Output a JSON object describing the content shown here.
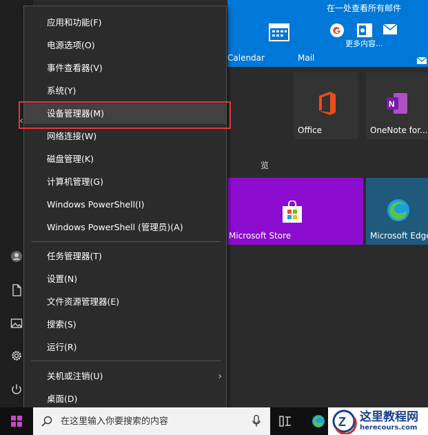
{
  "tiles": {
    "calendar": "Calendar",
    "mail": "Mail",
    "mail_header": "在一处查看所有邮件",
    "mail_more": "更多内容...",
    "office": "Office",
    "onenote": "OneNote for...",
    "store": "Microsoft Store",
    "edge": "Microsoft Edge",
    "group_fragment": "览"
  },
  "menu": {
    "items": [
      {
        "label": "应用和功能(F)"
      },
      {
        "label": "电源选项(O)"
      },
      {
        "label": "事件查看器(V)"
      },
      {
        "label": "系统(Y)"
      },
      {
        "label": "设备管理器(M)"
      },
      {
        "label": "网络连接(W)"
      },
      {
        "label": "磁盘管理(K)"
      },
      {
        "label": "计算机管理(G)"
      },
      {
        "label": "Windows PowerShell(I)"
      },
      {
        "label": "Windows PowerShell (管理员)(A)"
      },
      {
        "label": "任务管理器(T)"
      },
      {
        "label": "设置(N)"
      },
      {
        "label": "文件资源管理器(E)"
      },
      {
        "label": "搜索(S)"
      },
      {
        "label": "运行(R)"
      },
      {
        "label": "关机或注销(U)"
      },
      {
        "label": "桌面(D)"
      }
    ]
  },
  "taskbar": {
    "search_placeholder": "在这里输入你要搜索的内容"
  },
  "watermark": {
    "title": "这里教程网",
    "url": "herecours.com"
  },
  "colors": {
    "highlight_box": "#e03a3a",
    "tile_blue": "#0078d7",
    "tile_purple": "#8b0ccf"
  }
}
